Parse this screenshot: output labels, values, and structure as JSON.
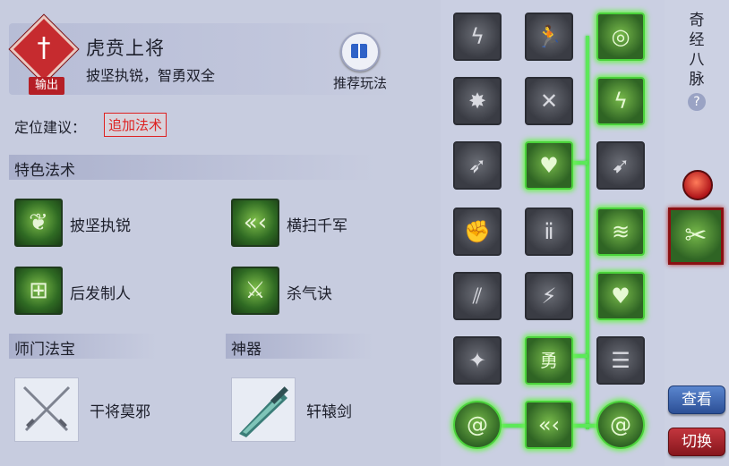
{
  "role": {
    "tag": "输出",
    "name": "虎贲上将",
    "description": "披坚执锐，智勇双全",
    "recommend_label": "推荐玩法"
  },
  "positioning": {
    "label": "定位建议：",
    "value": "追加法术"
  },
  "special_skills": {
    "title": "特色法术",
    "items": [
      {
        "name": "披坚执锐",
        "icon": "cabbage-leaf-icon"
      },
      {
        "name": "横扫千军",
        "icon": "triple-chevron-icon"
      },
      {
        "name": "后发制人",
        "icon": "gate-icon"
      },
      {
        "name": "杀气诀",
        "icon": "blade-icon"
      }
    ]
  },
  "sect_treasure": {
    "title": "师门法宝",
    "name": "干将莫邪",
    "icon": "crossed-swords-icon"
  },
  "artifact": {
    "title": "神器",
    "name": "轩辕剑",
    "icon": "jade-sword-icon"
  },
  "meridian_tree": {
    "rows": [
      [
        {
          "icon": "lightning-warrior-icon",
          "active": false
        },
        {
          "icon": "runner-icon",
          "active": false
        },
        {
          "icon": "swirl-icon",
          "active": true
        }
      ],
      [
        {
          "icon": "burst-figure-icon",
          "active": false
        },
        {
          "icon": "crossed-blade-icon",
          "active": false
        },
        {
          "icon": "lightning-bolts-icon",
          "active": true
        }
      ],
      [
        {
          "icon": "feather-blade-icon",
          "active": false
        },
        {
          "icon": "bleeding-heart-icon",
          "active": true
        },
        {
          "icon": "arrow-strike-icon",
          "active": false
        }
      ],
      [
        {
          "icon": "fist-icon",
          "active": false
        },
        {
          "icon": "twin-warriors-icon",
          "active": false
        },
        {
          "icon": "scroll-hand-icon",
          "active": true
        }
      ],
      [
        {
          "icon": "slash-marks-icon",
          "active": false
        },
        {
          "icon": "sprinter-icon",
          "active": false
        },
        {
          "icon": "broken-heart-icon",
          "active": true
        }
      ],
      [
        {
          "icon": "shattered-sword-icon",
          "active": false
        },
        {
          "icon": "courage-emblem-icon",
          "active": true
        },
        {
          "icon": "talisman-icon",
          "active": false
        }
      ],
      [
        {
          "icon": "spiral-orb-icon",
          "active": true
        },
        {
          "icon": "triple-chevron-icon",
          "active": true
        },
        {
          "icon": "spiral-orb-icon",
          "active": true
        }
      ]
    ]
  },
  "meridian_panel": {
    "title": "奇经八脉",
    "help": "?",
    "selected_icon": "butterfly-blade-icon",
    "view_button": "查看",
    "switch_button": "切换"
  },
  "colors": {
    "accent_green": "#4ad23a",
    "danger_red": "#c62b2f",
    "button_blue": "#2c4f96",
    "button_red": "#86161c"
  }
}
